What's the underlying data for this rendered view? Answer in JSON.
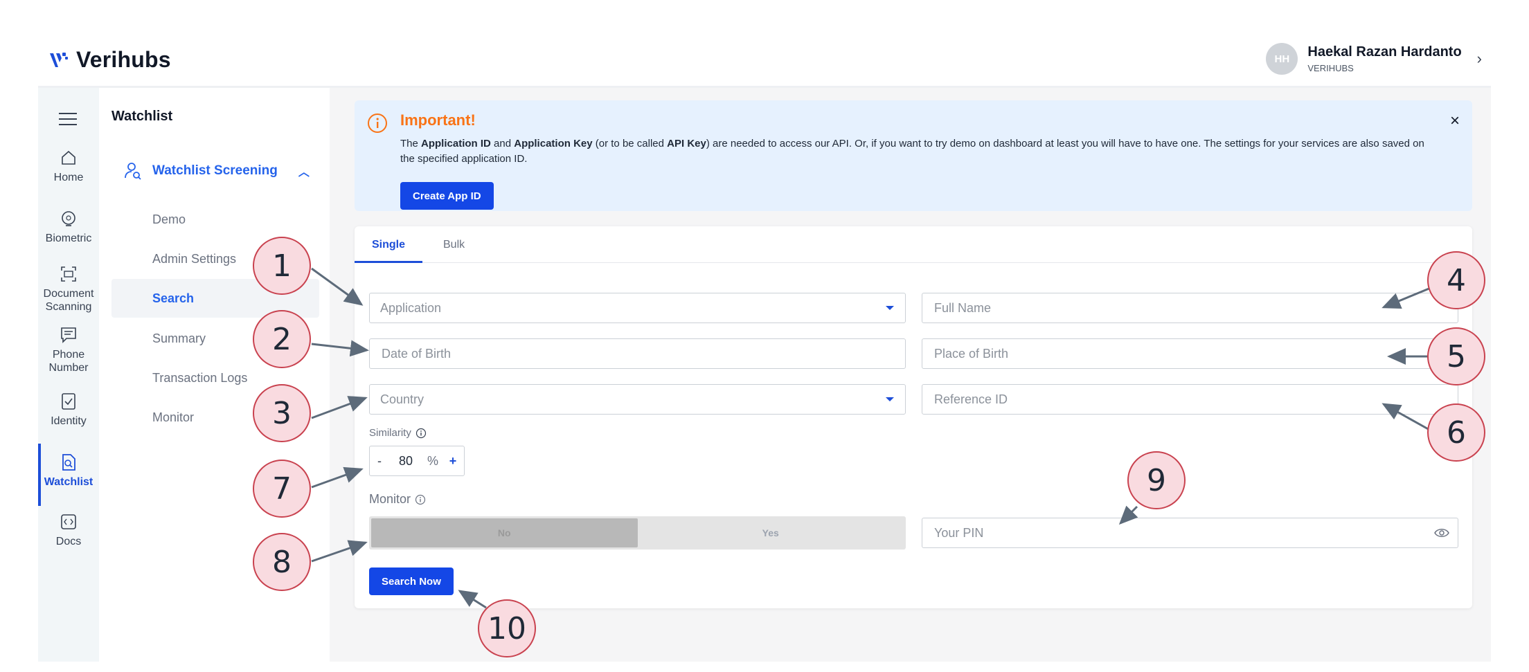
{
  "brand": {
    "name": "Verihubs"
  },
  "user": {
    "initials": "HH",
    "name": "Haekal Razan Hardanto",
    "org": "VERIHUBS",
    "chevron": "›"
  },
  "rail": {
    "items": [
      {
        "label": "Home"
      },
      {
        "label": "Biometric"
      },
      {
        "label": "Document Scanning"
      },
      {
        "label": "Phone Number"
      },
      {
        "label": "Identity"
      },
      {
        "label": "Watchlist"
      },
      {
        "label": "Docs"
      }
    ],
    "active": "Watchlist"
  },
  "submenu": {
    "title": "Watchlist",
    "group": "Watchlist Screening",
    "items": [
      "Demo",
      "Admin Settings",
      "Search",
      "Summary",
      "Transaction Logs",
      "Monitor"
    ],
    "active": "Search"
  },
  "alert": {
    "title": "Important!",
    "text_parts": {
      "p1": "The ",
      "b1": "Application ID",
      "p2": " and ",
      "b2": "Application Key",
      "p3": " (or to be called ",
      "b3": "API Key",
      "p4": ") are needed to access our API. Or, if you want to try demo on dashboard at least you will have to have one. The settings for your services are also saved on the specified application ID."
    },
    "button": "Create App ID",
    "close": "×"
  },
  "tabs": {
    "single": "Single",
    "bulk": "Bulk",
    "active": "Single"
  },
  "form": {
    "application_placeholder": "Application",
    "full_name_placeholder": "Full Name",
    "dob_placeholder": "Date of Birth",
    "pob_placeholder": "Place of Birth",
    "country_placeholder": "Country",
    "reference_placeholder": "Reference ID",
    "similarity_label": "Similarity",
    "similarity": {
      "minus": "-",
      "value": "80",
      "unit": "%",
      "plus": "+"
    },
    "monitor_label": "Monitor",
    "monitor_no": "No",
    "monitor_yes": "Yes",
    "monitor_selected": "No",
    "pin_placeholder": "Your PIN",
    "search_button": "Search Now"
  },
  "annotations": [
    "1",
    "2",
    "3",
    "4",
    "5",
    "6",
    "7",
    "8",
    "9",
    "10"
  ],
  "colors": {
    "primary": "#1447e6",
    "accent_orange": "#f97316",
    "annotation_fill": "#f9dbe0",
    "annotation_border": "#c9424f"
  }
}
